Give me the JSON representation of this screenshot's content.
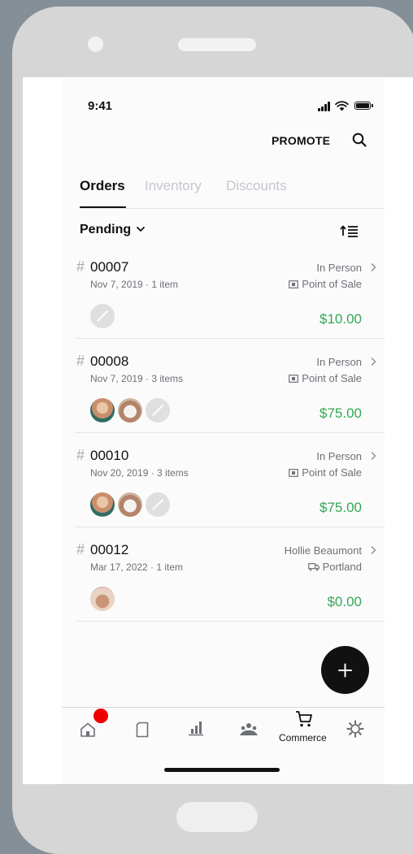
{
  "status": {
    "time": "9:41"
  },
  "header": {
    "promote_label": "PROMOTE",
    "search_icon": "search-icon"
  },
  "tabs": [
    {
      "label": "Orders",
      "active": true
    },
    {
      "label": "Inventory",
      "active": false
    },
    {
      "label": "Discounts",
      "active": false
    }
  ],
  "filter": {
    "label": "Pending"
  },
  "orders": [
    {
      "hash": "#",
      "number": "00007",
      "meta": "Nov 7, 2019 · 1 item",
      "channel": "In Person",
      "source": "Point of Sale",
      "source_icon": "cash-register-icon",
      "price": "$10.00",
      "thumbs": [
        "placeholder"
      ]
    },
    {
      "hash": "#",
      "number": "00008",
      "meta": "Nov 7, 2019 · 3 items",
      "channel": "In Person",
      "source": "Point of Sale",
      "source_icon": "cash-register-icon",
      "price": "$75.00",
      "thumbs": [
        "food",
        "mug",
        "placeholder"
      ]
    },
    {
      "hash": "#",
      "number": "00010",
      "meta": "Nov 20, 2019 · 3 items",
      "channel": "In Person",
      "source": "Point of Sale",
      "source_icon": "cash-register-icon",
      "price": "$75.00",
      "thumbs": [
        "food",
        "mug",
        "placeholder"
      ]
    },
    {
      "hash": "#",
      "number": "00012",
      "meta": "Mar 17, 2022 · 1 item",
      "channel": "Hollie Beaumont",
      "source": "Portland",
      "source_icon": "truck-icon",
      "price": "$0.00",
      "thumbs": [
        "bread"
      ]
    }
  ],
  "nav": {
    "items": [
      {
        "icon": "home-icon",
        "label": ""
      },
      {
        "icon": "document-icon",
        "label": ""
      },
      {
        "icon": "bar-chart-icon",
        "label": ""
      },
      {
        "icon": "customers-icon",
        "label": ""
      },
      {
        "icon": "cart-icon",
        "label": "Commerce"
      },
      {
        "icon": "gear-icon",
        "label": ""
      }
    ]
  },
  "colors": {
    "price": "#34a853",
    "badge": "#e00000",
    "accent": "#111111"
  }
}
